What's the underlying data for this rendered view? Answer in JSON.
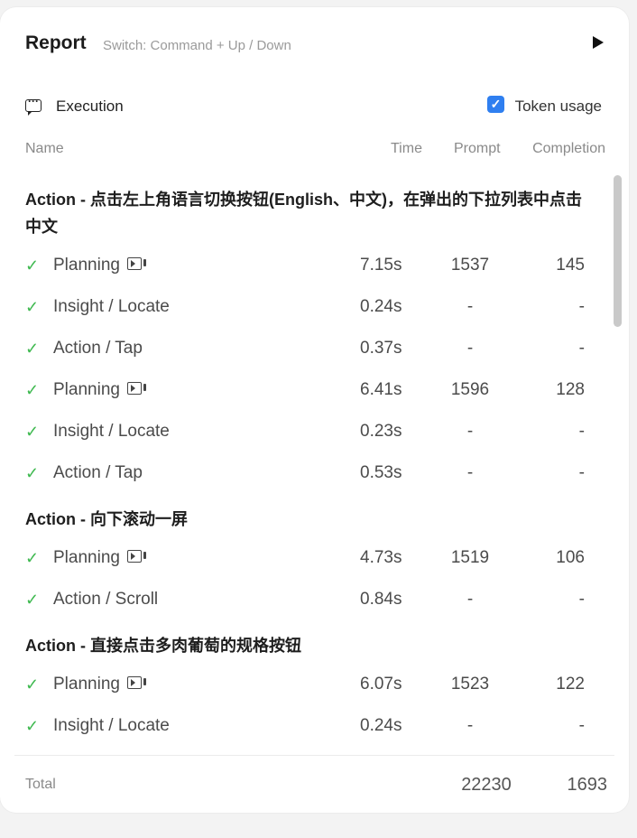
{
  "header": {
    "title": "Report",
    "hint": "Switch: Command + Up / Down"
  },
  "toolbar": {
    "execution_label": "Execution",
    "token_usage_label": "Token usage",
    "token_usage_checked": true
  },
  "columns": {
    "name": "Name",
    "time": "Time",
    "prompt": "Prompt",
    "completion": "Completion"
  },
  "groups": [
    {
      "title": "Action - 点击左上角语言切换按钮(English、中文)，在弹出的下拉列表中点击中文",
      "steps": [
        {
          "name": "Planning",
          "video": true,
          "time": "7.15s",
          "prompt": "1537",
          "completion": "145"
        },
        {
          "name": "Insight / Locate",
          "video": false,
          "time": "0.24s",
          "prompt": "-",
          "completion": "-"
        },
        {
          "name": "Action / Tap",
          "video": false,
          "time": "0.37s",
          "prompt": "-",
          "completion": "-"
        },
        {
          "name": "Planning",
          "video": true,
          "time": "6.41s",
          "prompt": "1596",
          "completion": "128"
        },
        {
          "name": "Insight / Locate",
          "video": false,
          "time": "0.23s",
          "prompt": "-",
          "completion": "-"
        },
        {
          "name": "Action / Tap",
          "video": false,
          "time": "0.53s",
          "prompt": "-",
          "completion": "-"
        }
      ]
    },
    {
      "title": "Action - 向下滚动一屏",
      "steps": [
        {
          "name": "Planning",
          "video": true,
          "time": "4.73s",
          "prompt": "1519",
          "completion": "106"
        },
        {
          "name": "Action / Scroll",
          "video": false,
          "time": "0.84s",
          "prompt": "-",
          "completion": "-"
        }
      ]
    },
    {
      "title": "Action - 直接点击多肉葡萄的规格按钮",
      "steps": [
        {
          "name": "Planning",
          "video": true,
          "time": "6.07s",
          "prompt": "1523",
          "completion": "122"
        },
        {
          "name": "Insight / Locate",
          "video": false,
          "time": "0.24s",
          "prompt": "-",
          "completion": "-"
        }
      ]
    }
  ],
  "footer": {
    "total_label": "Total",
    "total_prompt": "22230",
    "total_completion": "1693"
  },
  "icons": {
    "play": "play-icon",
    "execution": "message-dots-icon",
    "check": "check-icon",
    "video": "video-icon"
  },
  "colors": {
    "accent": "#2f7ff0",
    "success": "#3fb950"
  }
}
